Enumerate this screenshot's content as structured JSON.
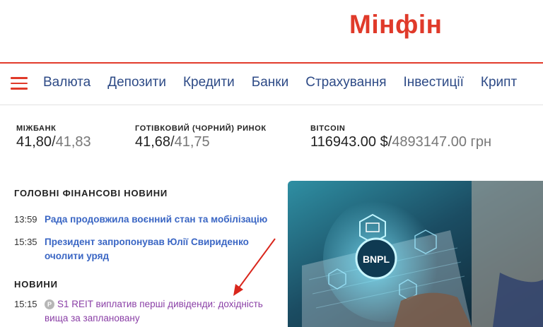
{
  "header": {
    "logo_text": "Мінфін"
  },
  "nav": {
    "menu_icon": "hamburger-icon",
    "items": [
      "Валюта",
      "Депозити",
      "Кредити",
      "Банки",
      "Страхування",
      "Інвестиції",
      "Крипт"
    ]
  },
  "rates": [
    {
      "label": "МІЖБАНК",
      "buy": "41,80",
      "sep": "/",
      "sell": "41,83"
    },
    {
      "label": "ГОТІВКОВИЙ (ЧОРНИЙ) РИНОК",
      "buy": "41,68",
      "sep": "/",
      "sell": "41,75"
    },
    {
      "label": "BITCOIN",
      "buy": "116943.00 $",
      "sep": "/",
      "sell": "4893147.00 грн"
    }
  ],
  "main_news": {
    "title": "ГОЛОВНІ ФІНАНСОВІ НОВИНИ",
    "items": [
      {
        "time": "13:59",
        "text": "Рада продовжила воєнний стан та мобілізацію"
      },
      {
        "time": "15:35",
        "text": "Президент запропонував Юлії Свириденко очолити уряд"
      }
    ]
  },
  "news": {
    "title": "НОВИНИ",
    "items": [
      {
        "time": "15:15",
        "badge": "P",
        "text": "S1 REIT виплатив перші дивіденди: дохідність вища за заплановану"
      }
    ]
  },
  "image": {
    "label": "BNPL",
    "icon": "cart-icon"
  },
  "colors": {
    "brand": "#e03a2a",
    "nav_link": "#2d4a86",
    "news_link": "#3a66c4",
    "visited_link": "#8a3fa6",
    "annotation": "#d9261c"
  }
}
